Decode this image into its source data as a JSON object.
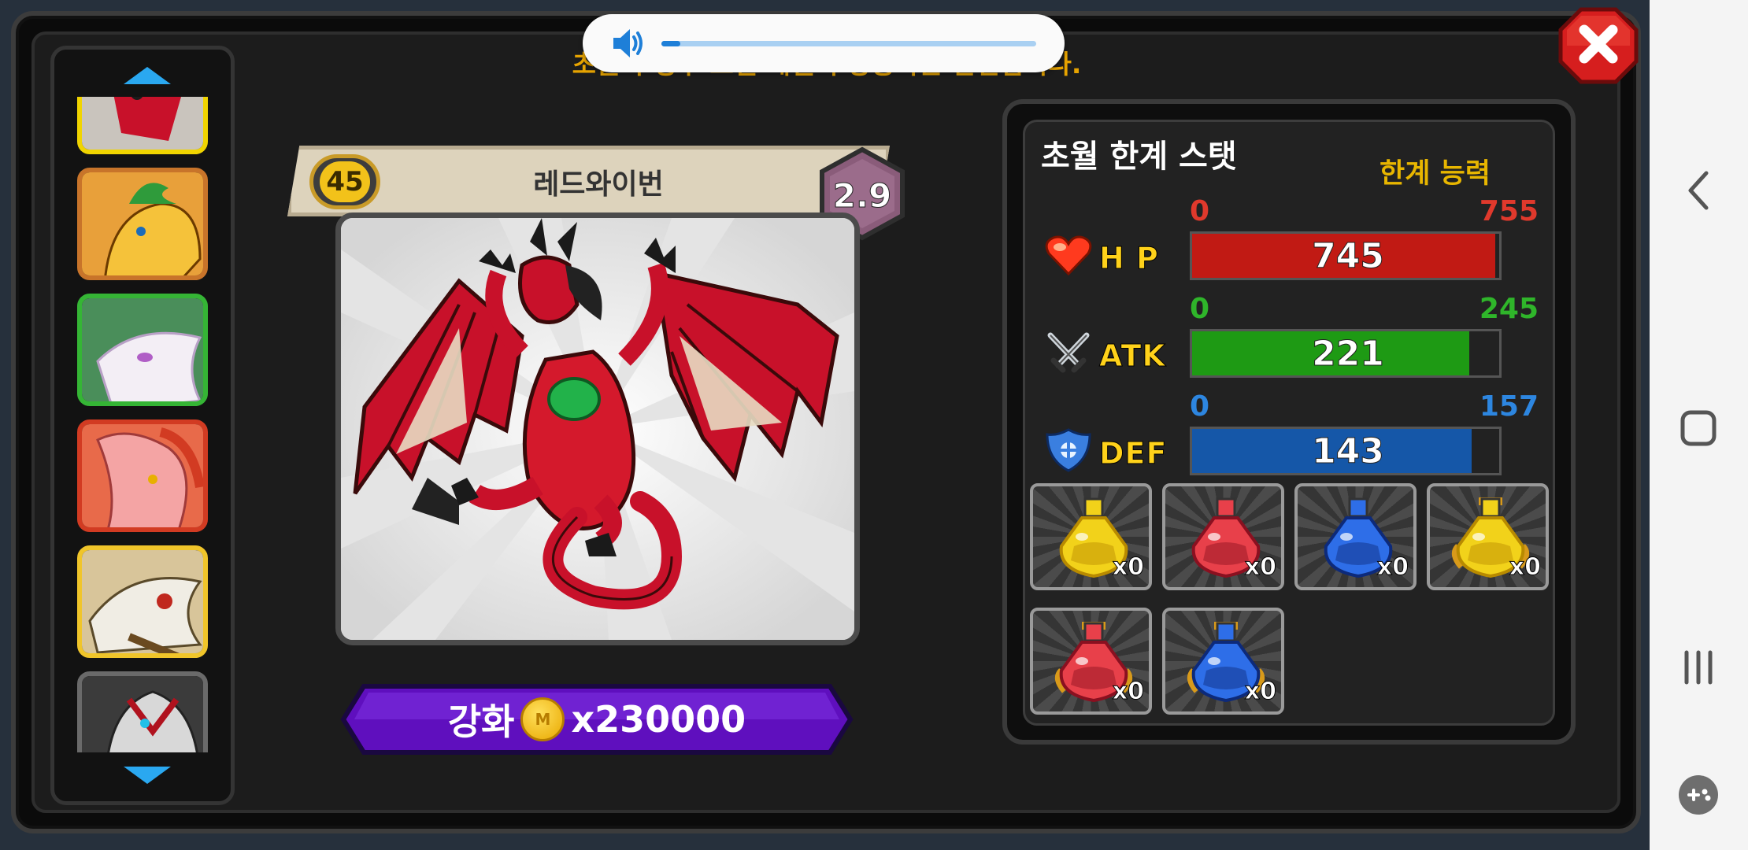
{
  "banner_text": "초월의 경우 스킬 레벨이 상승하는 반면입니다.",
  "volume": {
    "level": 0.05
  },
  "character": {
    "level": "45",
    "name": "레드와이번",
    "grade": "2.9"
  },
  "upgrade": {
    "label": "강화",
    "cost": "x230000",
    "coin_mark": "M"
  },
  "stats_panel": {
    "title": "초월 한계 스탯",
    "limit_label": "한계 능력",
    "rows": [
      {
        "name": "H P",
        "min": "0",
        "max": "755",
        "value": "745",
        "fraction": 0.987,
        "color": "#c11a14",
        "minmax_color": "#e0392c"
      },
      {
        "name": "ATK",
        "min": "0",
        "max": "245",
        "value": "221",
        "fraction": 0.902,
        "color": "#1e9a14",
        "minmax_color": "#2fb52a"
      },
      {
        "name": "DEF",
        "min": "0",
        "max": "157",
        "value": "143",
        "fraction": 0.911,
        "color": "#1557a8",
        "minmax_color": "#2d86e0"
      }
    ]
  },
  "potions": [
    {
      "type": "yellow",
      "qty": "x0"
    },
    {
      "type": "red",
      "qty": "x0"
    },
    {
      "type": "blue",
      "qty": "x0"
    },
    {
      "type": "gold-yellow",
      "qty": "x0"
    },
    {
      "type": "gold-red",
      "qty": "x0"
    },
    {
      "type": "gold-blue",
      "qty": "x0"
    }
  ],
  "thumbnails": [
    {
      "name": "red-wyvern",
      "border": "#f0d400"
    },
    {
      "name": "gold-dragon",
      "border": "#c8742a"
    },
    {
      "name": "white-dragon",
      "border": "#35b535"
    },
    {
      "name": "pink-dragon",
      "border": "#d23b22"
    },
    {
      "name": "bone-dragon",
      "border": "#f0c52a"
    },
    {
      "name": "dark-dragon",
      "border": "#6a6a6a"
    }
  ]
}
